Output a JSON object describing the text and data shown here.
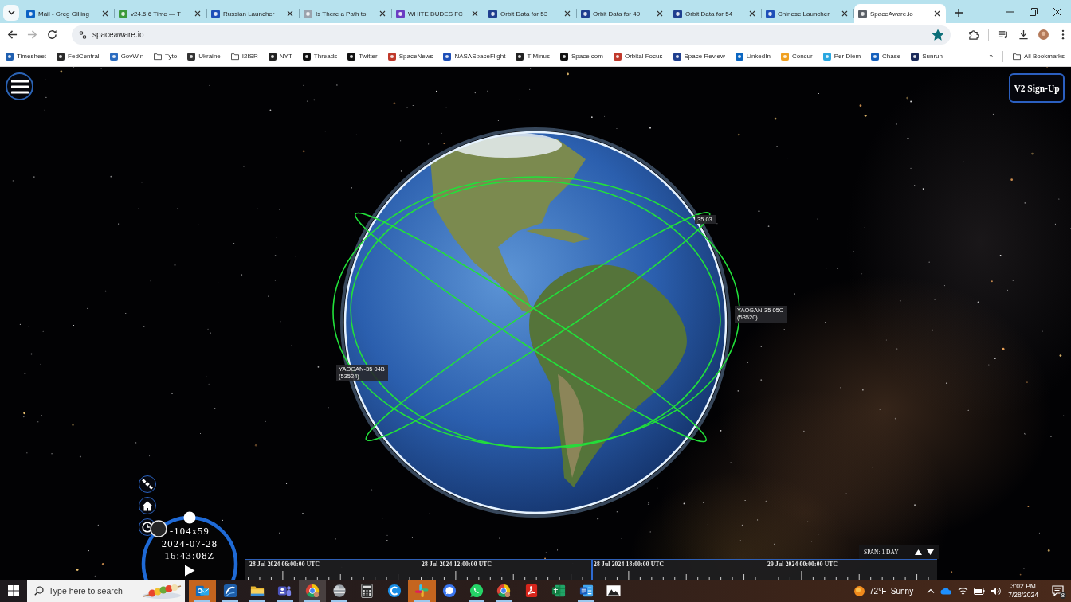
{
  "tabs": [
    {
      "title": "Mail - Greg Gilling",
      "selected": false
    },
    {
      "title": "v24.5.6 Time — T",
      "selected": false
    },
    {
      "title": "Russian Launcher",
      "selected": false
    },
    {
      "title": "Is There a Path to",
      "selected": false
    },
    {
      "title": "WHITE DUDES FC",
      "selected": false
    },
    {
      "title": "Orbit Data for 53",
      "selected": false
    },
    {
      "title": "Orbit Data for 49",
      "selected": false
    },
    {
      "title": "Orbit Data for 54",
      "selected": false
    },
    {
      "title": "Chinese Launcher",
      "selected": false
    },
    {
      "title": "SpaceAware.io",
      "selected": true
    }
  ],
  "toolbar": {
    "url": "spaceaware.io",
    "bookmarked": true,
    "can_go_forward": false
  },
  "bookmarks": {
    "items": [
      {
        "label": "Timesheet",
        "kind": "site"
      },
      {
        "label": "FedCentral",
        "kind": "site"
      },
      {
        "label": "GovWin",
        "kind": "site"
      },
      {
        "label": "Tyto",
        "kind": "folder"
      },
      {
        "label": "Ukraine",
        "kind": "site"
      },
      {
        "label": "I2ISR",
        "kind": "folder"
      },
      {
        "label": "NYT",
        "kind": "site"
      },
      {
        "label": "Threads",
        "kind": "site"
      },
      {
        "label": "Twitter",
        "kind": "site"
      },
      {
        "label": "SpaceNews",
        "kind": "site"
      },
      {
        "label": "NASASpaceFlight",
        "kind": "site"
      },
      {
        "label": "T-Minus",
        "kind": "site"
      },
      {
        "label": "Space.com",
        "kind": "site"
      },
      {
        "label": "Orbital Focus",
        "kind": "site"
      },
      {
        "label": "Space Review",
        "kind": "site"
      },
      {
        "label": "LinkedIn",
        "kind": "site"
      },
      {
        "label": "Concur",
        "kind": "site"
      },
      {
        "label": "Per Diem",
        "kind": "site"
      },
      {
        "label": "Chase",
        "kind": "site"
      },
      {
        "label": "Sunrun",
        "kind": "site"
      }
    ],
    "overflow": "»",
    "all_bookmarks": "All Bookmarks"
  },
  "viewer": {
    "signup_button": "V2 Sign-Up",
    "satellites": [
      {
        "name": "YAOGAN-35 04B",
        "number": "(53524)"
      },
      {
        "name": "YAOGAN-35 05C",
        "number": "(53520)"
      },
      {
        "name": "35 03"
      }
    ],
    "dial": {
      "coordinates": "-104x59",
      "date": "2024-07-28",
      "time": "16:43:08Z"
    },
    "timeline": {
      "labels": [
        "28 Jul 2024 06:00:00 UTC",
        "28 Jul 2024 12:00:00 UTC",
        "28 Jul 2024 18:00:00 UTC",
        "29 Jul 2024 00:00:00 UTC"
      ]
    },
    "span": "SPAN: 1 DAY"
  },
  "taskbar": {
    "search_placeholder": "Type here to search",
    "apps": [
      {
        "selected": false,
        "running": true,
        "attention": true
      },
      {
        "selected": false,
        "running": true,
        "attention": false
      },
      {
        "selected": false,
        "running": true,
        "attention": false
      },
      {
        "selected": false,
        "running": true,
        "attention": false
      },
      {
        "selected": true,
        "running": true,
        "attention": false
      },
      {
        "selected": false,
        "running": true,
        "attention": false
      },
      {
        "selected": false,
        "running": false,
        "attention": false
      },
      {
        "selected": false,
        "running": false,
        "attention": false
      },
      {
        "selected": false,
        "running": true,
        "attention": true
      },
      {
        "selected": false,
        "running": false,
        "attention": false
      },
      {
        "selected": false,
        "running": true,
        "attention": false
      },
      {
        "selected": false,
        "running": true,
        "attention": false
      },
      {
        "selected": false,
        "running": false,
        "attention": false
      },
      {
        "selected": false,
        "running": false,
        "attention": false
      },
      {
        "selected": false,
        "running": true,
        "attention": false
      },
      {
        "selected": false,
        "running": false,
        "attention": false
      }
    ],
    "weather": {
      "temperature": "72°F",
      "condition": "Sunny"
    },
    "time": "3:02 PM",
    "date": "7/28/2024",
    "notification_count": "8"
  }
}
